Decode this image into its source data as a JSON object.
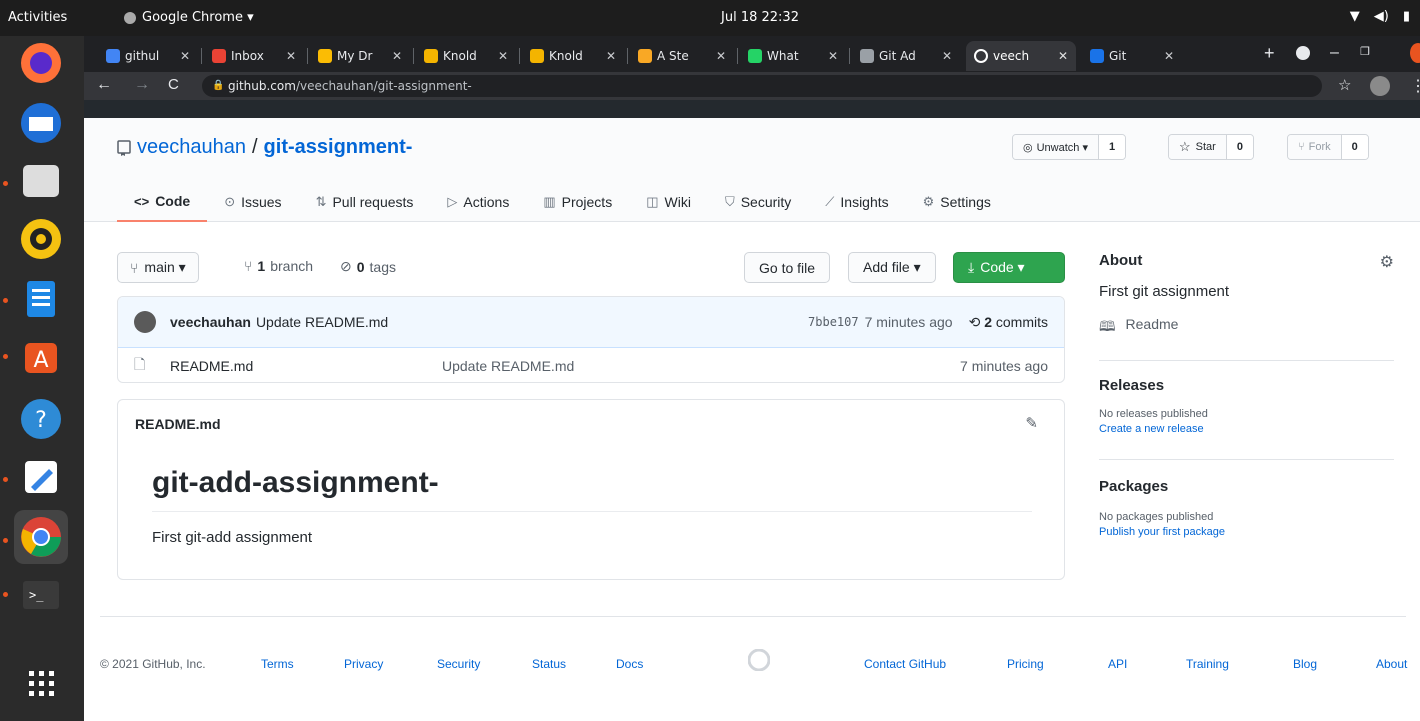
{
  "os": {
    "activities": "Activities",
    "app_name": "Google Chrome ▾",
    "clock": "Jul 18 22:32"
  },
  "browser": {
    "tabs": [
      {
        "label": "githul",
        "color": "#4285f4"
      },
      {
        "label": "Inbox",
        "color": "#ea4335"
      },
      {
        "label": "My Dr",
        "color": "#fbbc04"
      },
      {
        "label": "Knold",
        "color": "#f4b400"
      },
      {
        "label": "Knold",
        "color": "#f4b400"
      },
      {
        "label": "A Ste",
        "color": "#f9a825"
      },
      {
        "label": "What",
        "color": "#25d366"
      },
      {
        "label": "Git Ad",
        "color": "#9aa0a6"
      },
      {
        "label": "veech",
        "color": "#ffffff"
      },
      {
        "label": "Git",
        "color": "#1a73e8"
      }
    ],
    "new_tab": "+",
    "url_host": "github.com",
    "url_path": "/veechauhan/git-assignment-"
  },
  "repo": {
    "owner": "veechauhan",
    "separator": "/",
    "name": "git-assignment-",
    "unwatch_label": "Unwatch ▾",
    "watch_count": "1",
    "star_label": "Star",
    "star_count": "0",
    "fork_label": "Fork",
    "fork_count": "0",
    "tabs": [
      {
        "icon": "<>",
        "label": "Code"
      },
      {
        "icon": "⊙",
        "label": "Issues"
      },
      {
        "icon": "⇅",
        "label": "Pull requests"
      },
      {
        "icon": "▷",
        "label": "Actions"
      },
      {
        "icon": "▥",
        "label": "Projects"
      },
      {
        "icon": "◫",
        "label": "Wiki"
      },
      {
        "icon": "⛉",
        "label": "Security"
      },
      {
        "icon": "⟋",
        "label": "Insights"
      },
      {
        "icon": "⚙",
        "label": "Settings"
      }
    ]
  },
  "toolbar": {
    "branch": "main ▾",
    "branch_count": "1",
    "branch_word": "branch",
    "tag_count": "0",
    "tag_word": "tags",
    "go_to_file": "Go to file",
    "add_file": "Add file ▾",
    "code": "Code ▾"
  },
  "commit": {
    "author": "veechauhan",
    "message": "Update README.md",
    "sha": "7bbe107",
    "time": "7 minutes ago",
    "commit_count": "2",
    "commit_word": "commits"
  },
  "files": [
    {
      "name": "README.md",
      "message": "Update README.md",
      "time": "7 minutes ago"
    }
  ],
  "readme": {
    "filename": "README.md",
    "heading": "git-add-assignment-",
    "body": "First git-add assignment"
  },
  "sidebar": {
    "about_title": "About",
    "description": "First git assignment",
    "readme_link": "Readme",
    "releases_title": "Releases",
    "releases_none": "No releases published",
    "releases_link": "Create a new release",
    "packages_title": "Packages",
    "packages_none": "No packages published",
    "packages_link": "Publish your first package"
  },
  "footer": {
    "copyright": "© 2021 GitHub, Inc.",
    "links_left": [
      "Terms",
      "Privacy",
      "Security",
      "Status",
      "Docs"
    ],
    "links_right": [
      "Contact GitHub",
      "Pricing",
      "API",
      "Training",
      "Blog",
      "About"
    ]
  }
}
